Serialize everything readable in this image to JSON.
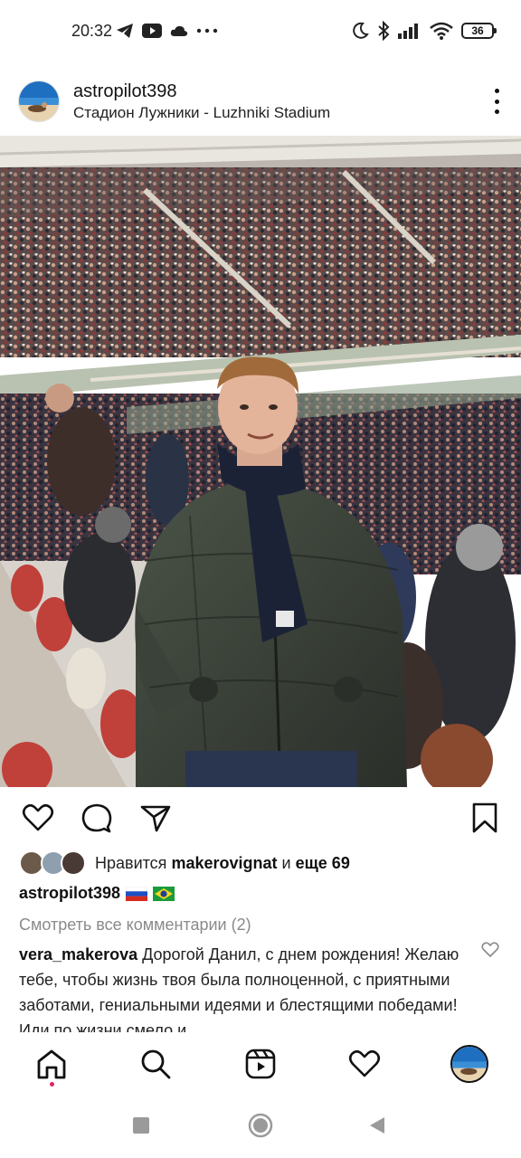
{
  "status_bar": {
    "time": "20:32",
    "battery": "36",
    "left_icons": [
      "telegram-icon",
      "youtube-icon",
      "cloud-icon",
      "more-dots-icon"
    ],
    "right_icons": [
      "moon-icon",
      "bluetooth-icon",
      "signal-icon",
      "wifi-icon",
      "battery-icon"
    ]
  },
  "post": {
    "username": "astropilot398",
    "location": "Стадион Лужники - Luzhniki Stadium",
    "likes": {
      "prefix": "Нравится",
      "user": "makerovignat",
      "connector": "и",
      "others": "еще 69"
    },
    "caption_user": "astropilot398",
    "view_comments": "Смотреть все комментарии (2)",
    "comment": {
      "user": "vera_makerova",
      "text": "Дорогой Данил, с днем рождения! Желаю тебе, чтобы жизнь твоя была полноценной, с приятными заботами, гениальными идеями и блестящими победами! Иди по жизни смело и"
    }
  },
  "actions": [
    "heart-icon",
    "comment-icon",
    "share-icon",
    "bookmark-icon"
  ],
  "bottom_nav": [
    "home-icon",
    "search-icon",
    "reels-icon",
    "activity-heart-icon",
    "profile-avatar"
  ],
  "colors": {
    "accent_dot": "#e0245e",
    "comment_muted": "#8a8a8a"
  }
}
